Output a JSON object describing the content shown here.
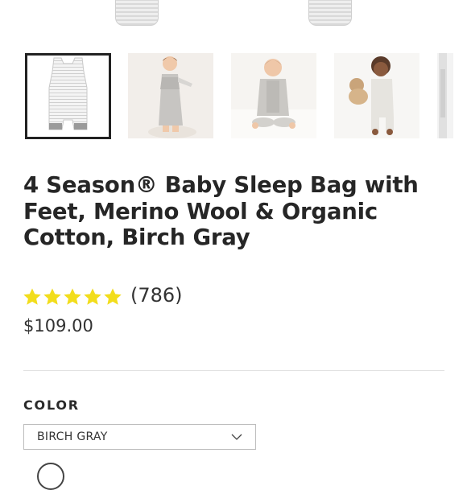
{
  "gallery": {
    "thumbnails": [
      {
        "name": "sleep-bag-flat",
        "selected": true
      },
      {
        "name": "toddler-standing",
        "selected": false
      },
      {
        "name": "baby-sitting",
        "selected": false
      },
      {
        "name": "baby-lying-bear",
        "selected": false
      },
      {
        "name": "partial-next",
        "selected": false
      }
    ]
  },
  "product": {
    "title": "4 Season® Baby Sleep Bag with Feet, Merino Wool & Organic Cotton, Birch Gray",
    "rating": 5,
    "review_count": "(786)",
    "price": "$109.00"
  },
  "color": {
    "label": "COLOR",
    "selected": "BIRCH GRAY"
  },
  "colors": {
    "star": "#f2dd1c",
    "text": "#262626",
    "border": "#bdbdbd"
  },
  "icons": {
    "zoom": "search-icon",
    "dropdown": "chevron-down-icon",
    "star": "star-icon"
  }
}
